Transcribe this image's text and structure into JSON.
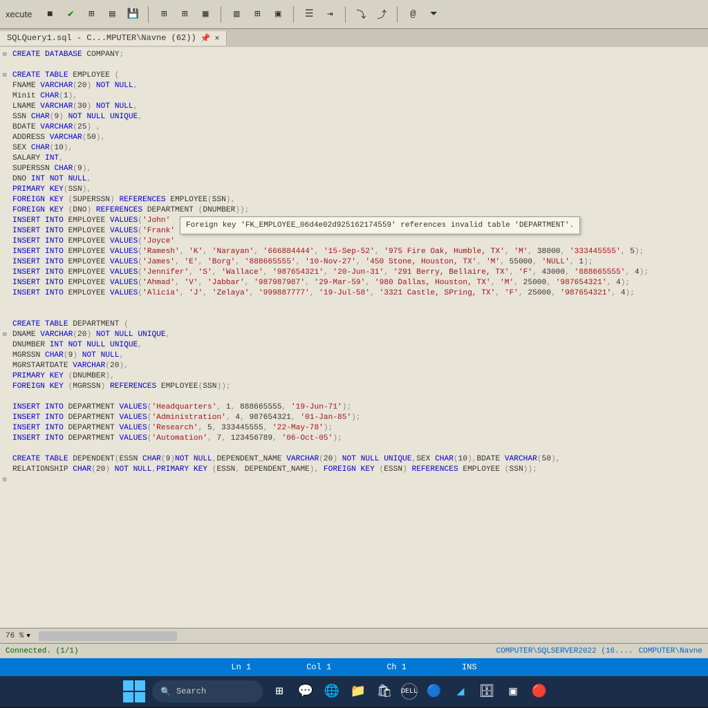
{
  "toolbar": {
    "execute_label": "xecute"
  },
  "tab": {
    "title": "SQLQuery1.sql - C...MPUTER\\Navne (62))"
  },
  "tooltip": {
    "text": "Foreign key 'FK_EMPLOYEE_06d4e02d925162174559' references invalid table 'DEPARTMENT'."
  },
  "code": {
    "l1": "CREATE DATABASE COMPANY;",
    "l2": "CREATE TABLE EMPLOYEE (",
    "l3": "FNAME VARCHAR(20) NOT NULL,",
    "l4": "Minit CHAR(1),",
    "l5": "LNAME VARCHAR(30) NOT NULL,",
    "l6": "SSN CHAR(9) NOT NULL UNIQUE,",
    "l7": "BDATE VARCHAR(25) ,",
    "l8": "ADDRESS VARCHAR(50),",
    "l9": "SEX CHAR(10),",
    "l10": "SALARY INT,",
    "l11": "SUPERSSN CHAR(9),",
    "l12": "DNO INT NOT NULL,",
    "l13": "PRIMARY KEY(SSN),",
    "l14": "FOREIGN KEY (SUPERSSN) REFERENCES EMPLOYEE(SSN),",
    "l15": "FOREIGN KEY (DNO) REFERENCES DEPARTMENT (DNUMBER));",
    "l16": "INSERT INTO EMPLOYEE VALUES('John'",
    "l17": "INSERT INTO EMPLOYEE VALUES('Frank'",
    "l18": "INSERT INTO EMPLOYEE VALUES('Joyce'",
    "l19": "INSERT INTO EMPLOYEE VALUES('Ramesh', 'K', 'Narayan', '666884444', '15-Sep-52', '975 Fire Oak, Humble, TX', 'M', 38000, '333445555', 5);",
    "l20": "INSERT INTO EMPLOYEE VALUES('James', 'E', 'Borg', '888665555', '10-Nov-27', '450 Stone, Houston, TX', 'M', 55000, 'NULL', 1);",
    "l21": "INSERT INTO EMPLOYEE VALUES('Jennifer', 'S', 'Wallace', '987654321', '20-Jun-31', '291 Berry, Bellaire, TX', 'F', 43000, '888665555', 4);",
    "l22": "INSERT INTO EMPLOYEE VALUES('Ahmad', 'V', 'Jabbar', '987987987', '29-Mar-59', '980 Dallas, Houston, TX', 'M', 25000, '987654321', 4);",
    "l23": "INSERT INTO EMPLOYEE VALUES('Alicia', 'J', 'Zelaya', '999887777', '19-Jul-58', '3321 Castle, SPring, TX', 'F', 25000, '987654321', 4);",
    "l24": "CREATE TABLE DEPARTMENT (",
    "l25": "DNAME VARCHAR(20) NOT NULL UNIQUE,",
    "l26": "DNUMBER INT NOT NULL UNIQUE,",
    "l27": "MGRSSN CHAR(9) NOT NULL,",
    "l28": "MGRSTARTDATE VARCHAR(20),",
    "l29": "PRIMARY KEY (DNUMBER),",
    "l30": "FOREIGN KEY (MGRSSN) REFERENCES EMPLOYEE(SSN));",
    "l31": "INSERT INTO DEPARTMENT VALUES('Headquarters', 1, 888665555, '19-Jun-71');",
    "l32": "INSERT INTO DEPARTMENT VALUES('Administration', 4, 987654321, '01-Jan-85');",
    "l33": "INSERT INTO DEPARTMENT VALUES('Research', 5, 333445555, '22-May-78');",
    "l34": "INSERT INTO DEPARTMENT VALUES('Automation', 7, 123456789, '06-Oct-05');",
    "l35": "CREATE TABLE DEPENDENT(ESSN CHAR(9)NOT NULL,DEPENDENT_NAME VARCHAR(20) NOT NULL UNIQUE,SEX CHAR(10),BDATE VARCHAR(50),",
    "l36": "RELATIONSHIP CHAR(20) NOT NULL,PRIMARY KEY (ESSN, DEPENDENT_NAME), FOREIGN KEY (ESSN) REFERENCES EMPLOYEE (SSN));"
  },
  "zoom": {
    "value": "76 %"
  },
  "status": {
    "connected": "Connected. (1/1)",
    "server": "COMPUTER\\SQLSERVER2022 (16....",
    "user": "COMPUTER\\Navne"
  },
  "bottom": {
    "ln": "Ln 1",
    "col": "Col 1",
    "ch": "Ch 1",
    "ins": "INS"
  },
  "taskbar": {
    "search": "Search"
  }
}
